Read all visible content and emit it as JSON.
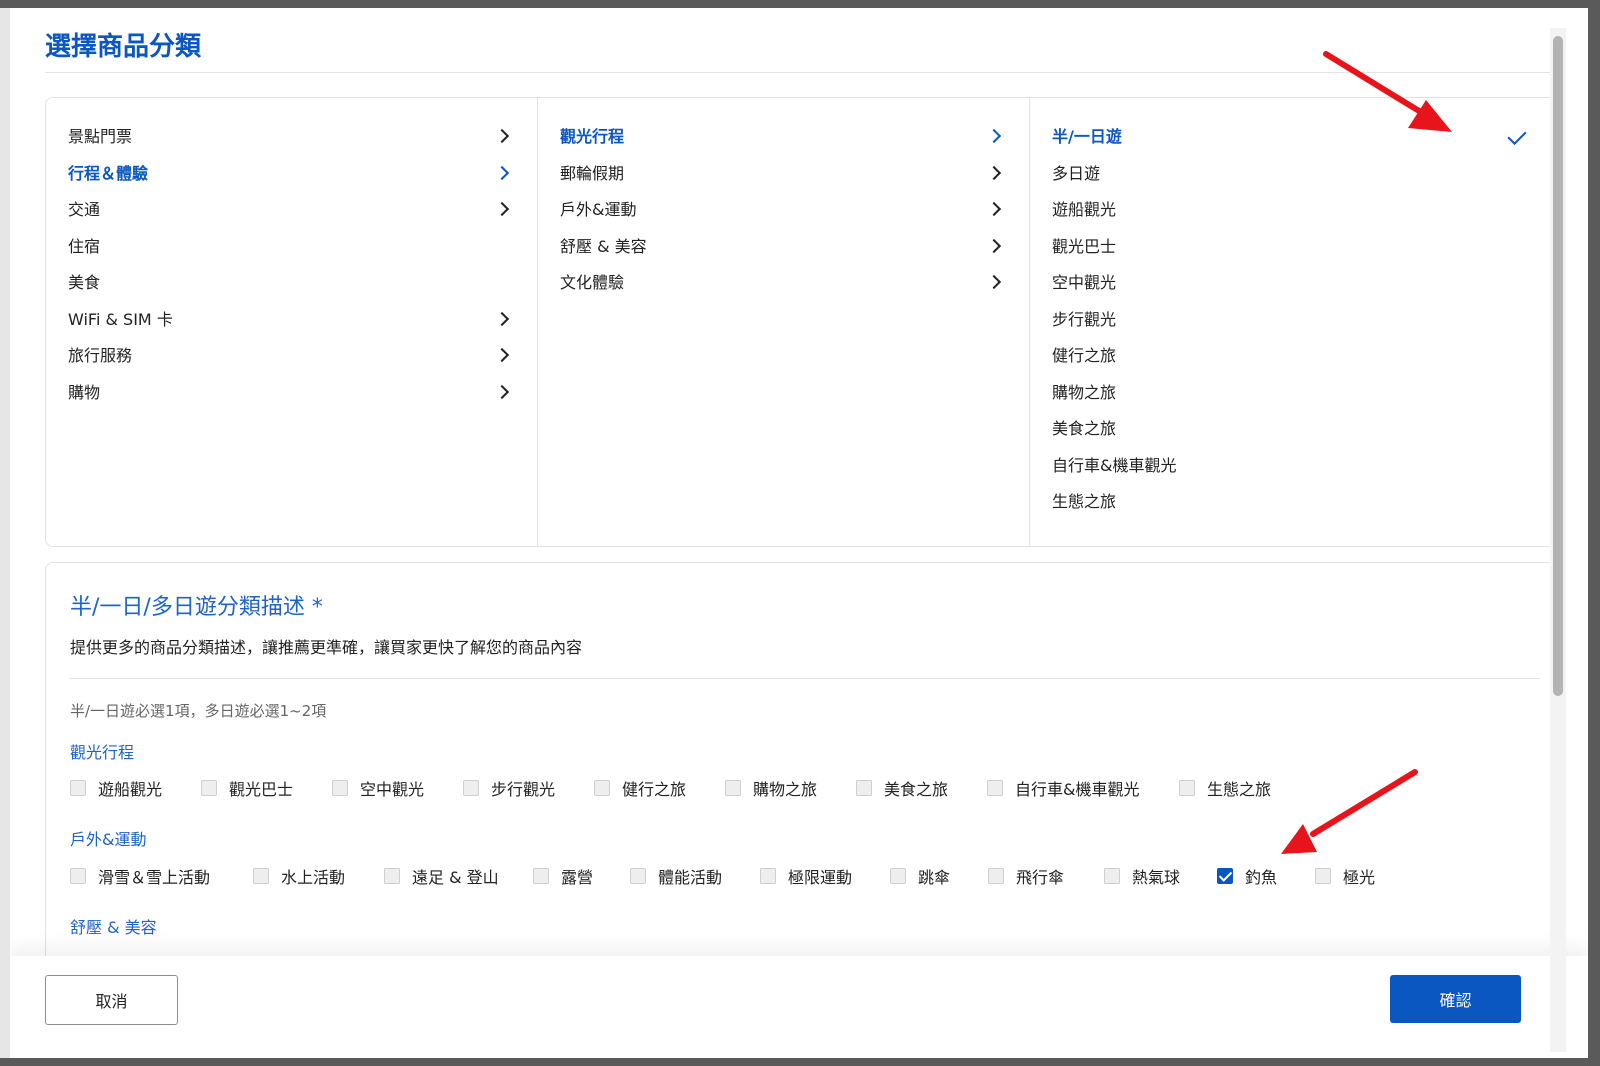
{
  "modal": {
    "title": "選擇商品分類",
    "cancel_label": "取消",
    "confirm_label": "確認"
  },
  "cascader": {
    "level1": [
      {
        "label": "景點門票",
        "has_children": true,
        "active": false
      },
      {
        "label": "行程＆體驗",
        "has_children": true,
        "active": true
      },
      {
        "label": "交通",
        "has_children": true,
        "active": false
      },
      {
        "label": "住宿",
        "has_children": false,
        "active": false
      },
      {
        "label": "美食",
        "has_children": false,
        "active": false
      },
      {
        "label": "WiFi & SIM 卡",
        "has_children": true,
        "active": false
      },
      {
        "label": "旅行服務",
        "has_children": true,
        "active": false
      },
      {
        "label": "購物",
        "has_children": true,
        "active": false
      }
    ],
    "level2": [
      {
        "label": "觀光行程",
        "has_children": true,
        "active": true
      },
      {
        "label": "郵輪假期",
        "has_children": true,
        "active": false
      },
      {
        "label": "戶外&運動",
        "has_children": true,
        "active": false
      },
      {
        "label": "舒壓 & 美容",
        "has_children": true,
        "active": false
      },
      {
        "label": "文化體驗",
        "has_children": true,
        "active": false
      }
    ],
    "level3": [
      {
        "label": "半/一日遊",
        "selected": true
      },
      {
        "label": "多日遊",
        "selected": false
      },
      {
        "label": "遊船觀光",
        "selected": false
      },
      {
        "label": "觀光巴士",
        "selected": false
      },
      {
        "label": "空中觀光",
        "selected": false
      },
      {
        "label": "步行觀光",
        "selected": false
      },
      {
        "label": "健行之旅",
        "selected": false
      },
      {
        "label": "購物之旅",
        "selected": false
      },
      {
        "label": "美食之旅",
        "selected": false
      },
      {
        "label": "自行車&機車觀光",
        "selected": false
      },
      {
        "label": "生態之旅",
        "selected": false
      }
    ]
  },
  "description": {
    "title": "半/一日/多日遊分類描述 *",
    "subtitle": "提供更多的商品分類描述，讓推薦更準確，讓買家更快了解您的商品內容",
    "hint": "半/一日遊必選1項，多日遊必選1~2項",
    "groups": [
      {
        "label": "觀光行程",
        "options": [
          {
            "label": "遊船觀光",
            "checked": false
          },
          {
            "label": "觀光巴士",
            "checked": false
          },
          {
            "label": "空中觀光",
            "checked": false
          },
          {
            "label": "步行觀光",
            "checked": false
          },
          {
            "label": "健行之旅",
            "checked": false
          },
          {
            "label": "購物之旅",
            "checked": false
          },
          {
            "label": "美食之旅",
            "checked": false
          },
          {
            "label": "自行車&機車觀光",
            "checked": false
          },
          {
            "label": "生態之旅",
            "checked": false
          }
        ]
      },
      {
        "label": "戶外&運動",
        "options": [
          {
            "label": "滑雪＆雪上活動",
            "checked": false
          },
          {
            "label": "水上活動",
            "checked": false
          },
          {
            "label": "遠足 & 登山",
            "checked": false
          },
          {
            "label": "露營",
            "checked": false
          },
          {
            "label": "體能活動",
            "checked": false
          },
          {
            "label": "極限運動",
            "checked": false
          },
          {
            "label": "跳傘",
            "checked": false
          },
          {
            "label": "飛行傘",
            "checked": false
          },
          {
            "label": "熱氣球",
            "checked": false
          },
          {
            "label": "釣魚",
            "checked": true
          },
          {
            "label": "極光",
            "checked": false
          }
        ]
      },
      {
        "label": "舒壓 & 美容",
        "options": []
      }
    ]
  },
  "colors": {
    "accent": "#0b57c1",
    "annotation_arrow": "#e8141b"
  },
  "icons": {
    "chevron": "chevron-right-icon",
    "selected": "checkmark-icon",
    "annotation": "red-arrow-icon"
  }
}
